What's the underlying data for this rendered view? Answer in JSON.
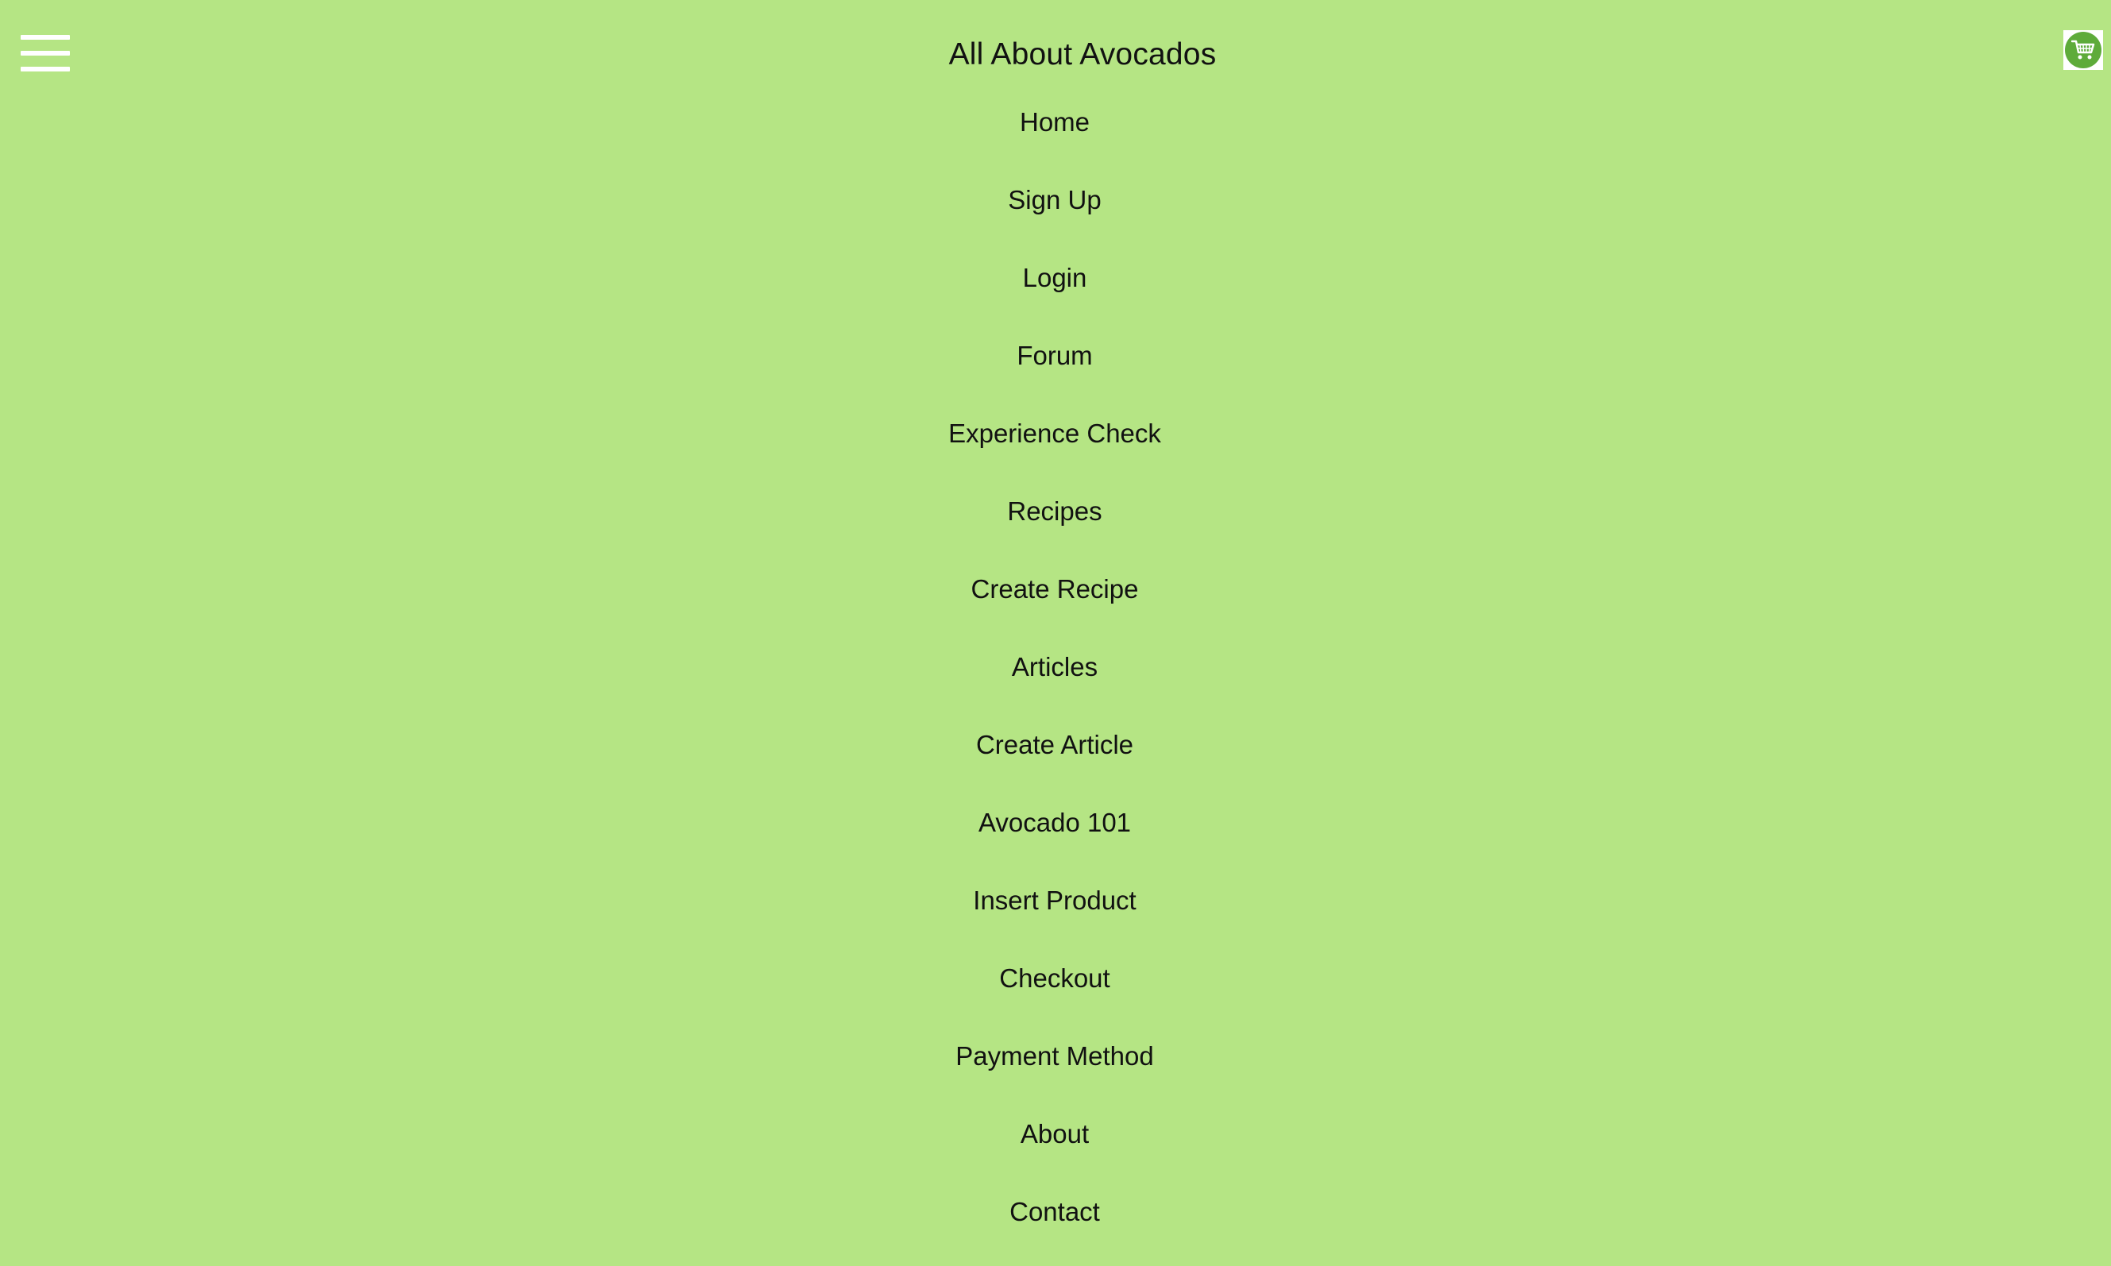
{
  "header": {
    "title": "All About Avocados",
    "menu_icon": "hamburger-menu-icon",
    "cart_icon": "shopping-cart-icon"
  },
  "nav": {
    "items": [
      {
        "label": "Home"
      },
      {
        "label": "Sign Up"
      },
      {
        "label": "Login"
      },
      {
        "label": "Forum"
      },
      {
        "label": "Experience Check"
      },
      {
        "label": "Recipes"
      },
      {
        "label": "Create Recipe"
      },
      {
        "label": "Articles"
      },
      {
        "label": "Create Article"
      },
      {
        "label": "Avocado 101"
      },
      {
        "label": "Insert Product"
      },
      {
        "label": "Checkout"
      },
      {
        "label": "Payment Method"
      },
      {
        "label": "About"
      },
      {
        "label": "Contact"
      }
    ]
  },
  "colors": {
    "background": "#b5e584",
    "text": "#111111",
    "menu_icon": "#ffffff",
    "cart_badge": "#5eab3a"
  }
}
